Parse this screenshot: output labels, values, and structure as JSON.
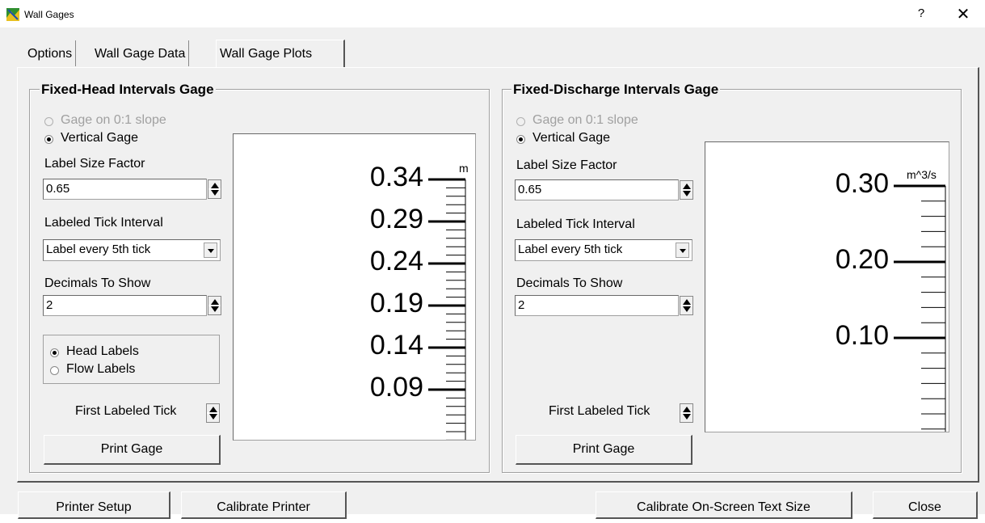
{
  "window": {
    "title": "Wall Gages",
    "help": "?",
    "close": "✕"
  },
  "tabs": [
    {
      "label": "Options",
      "mnemonic": "O"
    },
    {
      "label": "Wall Gage Data",
      "mnemonic": "W"
    },
    {
      "label": "Wall Gage Plots",
      "mnemonic": "g",
      "active": true
    }
  ],
  "left": {
    "title": "Fixed-Head Intervals Gage",
    "slope_option": "Gage on 0:1 slope",
    "vertical_option": "Vertical Gage",
    "label_size_label": "Label Size Factor",
    "label_size_value": "0.65",
    "tick_interval_label": "Labeled Tick Interval",
    "tick_interval_value": "Label every 5th tick",
    "decimals_label": "Decimals To Show",
    "decimals_value": "2",
    "head_labels": "Head Labels",
    "flow_labels": "Flow Labels",
    "first_tick_label": "First Labeled Tick",
    "print_button": "Print Gage",
    "unit": "m",
    "gage_labels": [
      "0.34",
      "0.29",
      "0.24",
      "0.19",
      "0.14",
      "0.09"
    ]
  },
  "right": {
    "title": "Fixed-Discharge Intervals Gage",
    "slope_option": "Gage on 0:1 slope",
    "vertical_option": "Vertical Gage",
    "label_size_label": "Label Size Factor",
    "label_size_value": "0.65",
    "tick_interval_label": "Labeled Tick Interval",
    "tick_interval_value": "Label every 5th tick",
    "decimals_label": "Decimals To Show",
    "decimals_value": "2",
    "first_tick_label": "First Labeled Tick",
    "print_button": "Print Gage",
    "unit": "m^3/s",
    "gage_labels": [
      "0.30",
      "0.20",
      "0.10"
    ]
  },
  "bottom": {
    "printer_setup": "Printer Setup",
    "calibrate_printer": "Calibrate Printer",
    "calibrate_text": "Calibrate On-Screen Text Size",
    "close": "Close"
  },
  "colors": {
    "face": "#f0f0f0",
    "disabled_text": "#a0a0a0"
  }
}
